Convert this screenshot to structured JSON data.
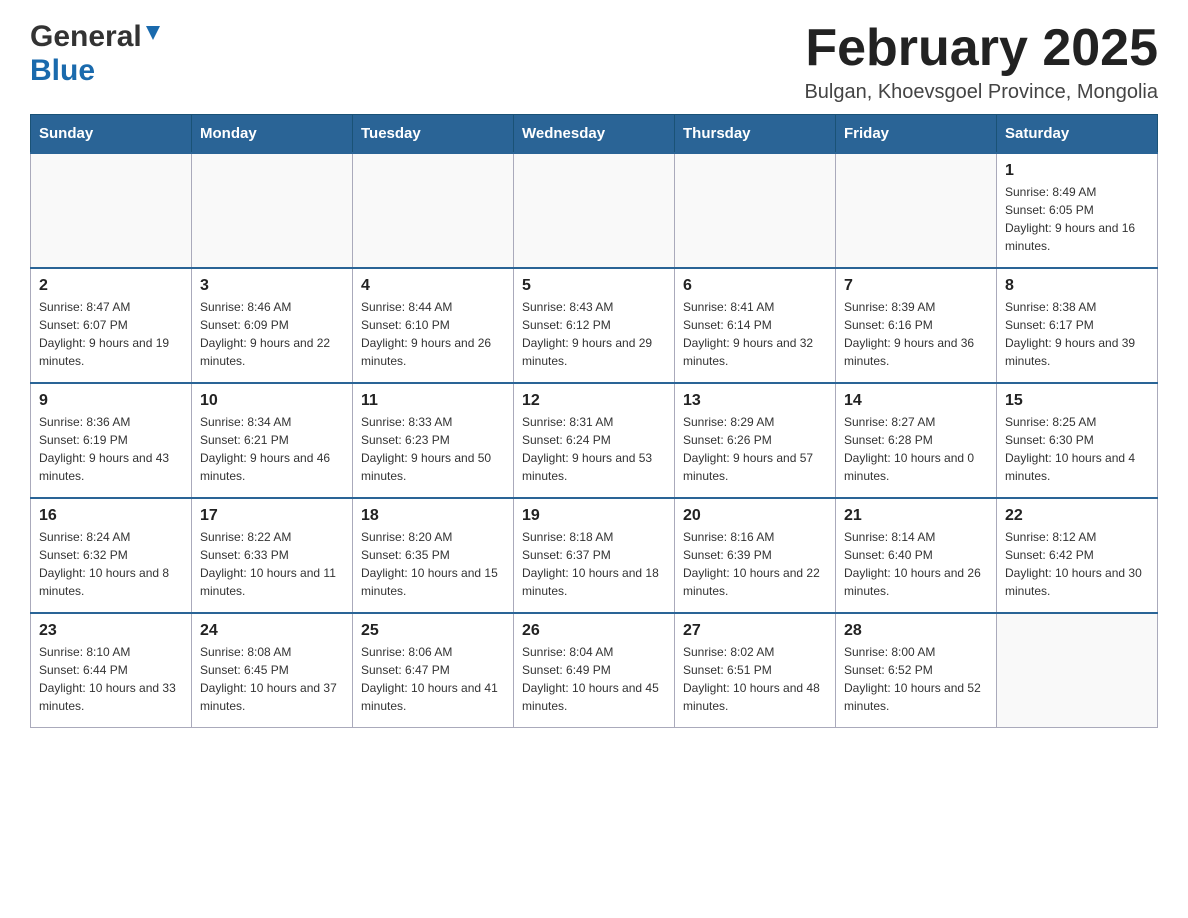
{
  "header": {
    "logo_general": "General",
    "logo_blue": "Blue",
    "month_title": "February 2025",
    "location": "Bulgan, Khoevsgoel Province, Mongolia"
  },
  "weekdays": [
    "Sunday",
    "Monday",
    "Tuesday",
    "Wednesday",
    "Thursday",
    "Friday",
    "Saturday"
  ],
  "weeks": [
    [
      {
        "day": "",
        "sunrise": "",
        "sunset": "",
        "daylight": ""
      },
      {
        "day": "",
        "sunrise": "",
        "sunset": "",
        "daylight": ""
      },
      {
        "day": "",
        "sunrise": "",
        "sunset": "",
        "daylight": ""
      },
      {
        "day": "",
        "sunrise": "",
        "sunset": "",
        "daylight": ""
      },
      {
        "day": "",
        "sunrise": "",
        "sunset": "",
        "daylight": ""
      },
      {
        "day": "",
        "sunrise": "",
        "sunset": "",
        "daylight": ""
      },
      {
        "day": "1",
        "sunrise": "Sunrise: 8:49 AM",
        "sunset": "Sunset: 6:05 PM",
        "daylight": "Daylight: 9 hours and 16 minutes."
      }
    ],
    [
      {
        "day": "2",
        "sunrise": "Sunrise: 8:47 AM",
        "sunset": "Sunset: 6:07 PM",
        "daylight": "Daylight: 9 hours and 19 minutes."
      },
      {
        "day": "3",
        "sunrise": "Sunrise: 8:46 AM",
        "sunset": "Sunset: 6:09 PM",
        "daylight": "Daylight: 9 hours and 22 minutes."
      },
      {
        "day": "4",
        "sunrise": "Sunrise: 8:44 AM",
        "sunset": "Sunset: 6:10 PM",
        "daylight": "Daylight: 9 hours and 26 minutes."
      },
      {
        "day": "5",
        "sunrise": "Sunrise: 8:43 AM",
        "sunset": "Sunset: 6:12 PM",
        "daylight": "Daylight: 9 hours and 29 minutes."
      },
      {
        "day": "6",
        "sunrise": "Sunrise: 8:41 AM",
        "sunset": "Sunset: 6:14 PM",
        "daylight": "Daylight: 9 hours and 32 minutes."
      },
      {
        "day": "7",
        "sunrise": "Sunrise: 8:39 AM",
        "sunset": "Sunset: 6:16 PM",
        "daylight": "Daylight: 9 hours and 36 minutes."
      },
      {
        "day": "8",
        "sunrise": "Sunrise: 8:38 AM",
        "sunset": "Sunset: 6:17 PM",
        "daylight": "Daylight: 9 hours and 39 minutes."
      }
    ],
    [
      {
        "day": "9",
        "sunrise": "Sunrise: 8:36 AM",
        "sunset": "Sunset: 6:19 PM",
        "daylight": "Daylight: 9 hours and 43 minutes."
      },
      {
        "day": "10",
        "sunrise": "Sunrise: 8:34 AM",
        "sunset": "Sunset: 6:21 PM",
        "daylight": "Daylight: 9 hours and 46 minutes."
      },
      {
        "day": "11",
        "sunrise": "Sunrise: 8:33 AM",
        "sunset": "Sunset: 6:23 PM",
        "daylight": "Daylight: 9 hours and 50 minutes."
      },
      {
        "day": "12",
        "sunrise": "Sunrise: 8:31 AM",
        "sunset": "Sunset: 6:24 PM",
        "daylight": "Daylight: 9 hours and 53 minutes."
      },
      {
        "day": "13",
        "sunrise": "Sunrise: 8:29 AM",
        "sunset": "Sunset: 6:26 PM",
        "daylight": "Daylight: 9 hours and 57 minutes."
      },
      {
        "day": "14",
        "sunrise": "Sunrise: 8:27 AM",
        "sunset": "Sunset: 6:28 PM",
        "daylight": "Daylight: 10 hours and 0 minutes."
      },
      {
        "day": "15",
        "sunrise": "Sunrise: 8:25 AM",
        "sunset": "Sunset: 6:30 PM",
        "daylight": "Daylight: 10 hours and 4 minutes."
      }
    ],
    [
      {
        "day": "16",
        "sunrise": "Sunrise: 8:24 AM",
        "sunset": "Sunset: 6:32 PM",
        "daylight": "Daylight: 10 hours and 8 minutes."
      },
      {
        "day": "17",
        "sunrise": "Sunrise: 8:22 AM",
        "sunset": "Sunset: 6:33 PM",
        "daylight": "Daylight: 10 hours and 11 minutes."
      },
      {
        "day": "18",
        "sunrise": "Sunrise: 8:20 AM",
        "sunset": "Sunset: 6:35 PM",
        "daylight": "Daylight: 10 hours and 15 minutes."
      },
      {
        "day": "19",
        "sunrise": "Sunrise: 8:18 AM",
        "sunset": "Sunset: 6:37 PM",
        "daylight": "Daylight: 10 hours and 18 minutes."
      },
      {
        "day": "20",
        "sunrise": "Sunrise: 8:16 AM",
        "sunset": "Sunset: 6:39 PM",
        "daylight": "Daylight: 10 hours and 22 minutes."
      },
      {
        "day": "21",
        "sunrise": "Sunrise: 8:14 AM",
        "sunset": "Sunset: 6:40 PM",
        "daylight": "Daylight: 10 hours and 26 minutes."
      },
      {
        "day": "22",
        "sunrise": "Sunrise: 8:12 AM",
        "sunset": "Sunset: 6:42 PM",
        "daylight": "Daylight: 10 hours and 30 minutes."
      }
    ],
    [
      {
        "day": "23",
        "sunrise": "Sunrise: 8:10 AM",
        "sunset": "Sunset: 6:44 PM",
        "daylight": "Daylight: 10 hours and 33 minutes."
      },
      {
        "day": "24",
        "sunrise": "Sunrise: 8:08 AM",
        "sunset": "Sunset: 6:45 PM",
        "daylight": "Daylight: 10 hours and 37 minutes."
      },
      {
        "day": "25",
        "sunrise": "Sunrise: 8:06 AM",
        "sunset": "Sunset: 6:47 PM",
        "daylight": "Daylight: 10 hours and 41 minutes."
      },
      {
        "day": "26",
        "sunrise": "Sunrise: 8:04 AM",
        "sunset": "Sunset: 6:49 PM",
        "daylight": "Daylight: 10 hours and 45 minutes."
      },
      {
        "day": "27",
        "sunrise": "Sunrise: 8:02 AM",
        "sunset": "Sunset: 6:51 PM",
        "daylight": "Daylight: 10 hours and 48 minutes."
      },
      {
        "day": "28",
        "sunrise": "Sunrise: 8:00 AM",
        "sunset": "Sunset: 6:52 PM",
        "daylight": "Daylight: 10 hours and 52 minutes."
      },
      {
        "day": "",
        "sunrise": "",
        "sunset": "",
        "daylight": ""
      }
    ]
  ]
}
